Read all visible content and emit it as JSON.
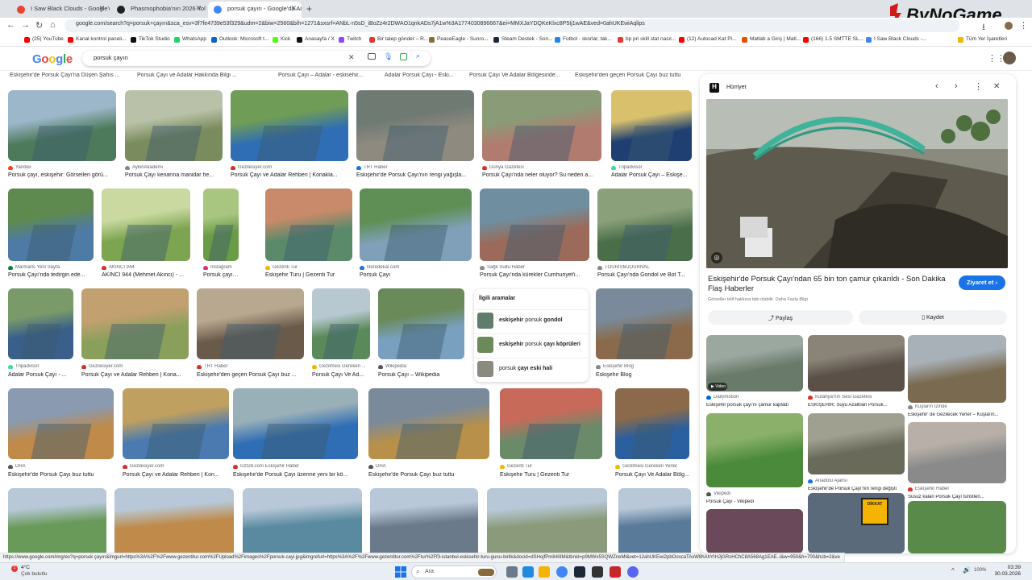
{
  "browser": {
    "tabs": [
      {
        "label": "I Saw Black Clouds - Google'da",
        "color": "#ea4335"
      },
      {
        "label": "Phasmophobia'nın 2026 Yol Ha...",
        "color": "#222222"
      },
      {
        "label": "porsuk çayırı - Google'da Ara",
        "color": "#4285f4"
      }
    ],
    "new_tab": "+",
    "url": "google.com/search?q=porsuk+çayırı&sca_esv=3f7fe4739e53f329&udm=2&biw=2560&bih=1271&sxsrf=ANbL-n5sD_iBoZz4r2DWAO1qnkADs7jA1w%3A1774030896667&ei=MMXJaYDQKeKlxc8P5Ij1wAE&ved=0ahUKEwiAqlips",
    "bookmarks": [
      {
        "label": "(25) YouTube",
        "color": "#ff0000"
      },
      {
        "label": "Kanal kontrol paneli...",
        "color": "#ff0000"
      },
      {
        "label": "TikTok Studio",
        "color": "#111111"
      },
      {
        "label": "WhatsApp",
        "color": "#25d366"
      },
      {
        "label": "Outlook: Microsoft t...",
        "color": "#0a64c8"
      },
      {
        "label": "Kick",
        "color": "#53fc18"
      },
      {
        "label": "Anasayfa / X",
        "color": "#111111"
      },
      {
        "label": "Twitch",
        "color": "#9146ff"
      },
      {
        "label": "Bir talep gönder – R...",
        "color": "#e53935"
      },
      {
        "label": "PeaceEagle - Sunro...",
        "color": "#8a6d3b"
      },
      {
        "label": "Steam Destek - Son...",
        "color": "#1b2838"
      },
      {
        "label": "Futbol - skorlar, tak...",
        "color": "#1e88e5"
      },
      {
        "label": "bp pri skill stat nasıl...",
        "color": "#e53935"
      },
      {
        "label": "(12) Autocad Kat Pl...",
        "color": "#ff0000"
      },
      {
        "label": "Matlab a Giriş | Matl...",
        "color": "#e65100"
      },
      {
        "label": "(166) 1.5 SMTTE SL...",
        "color": "#ff0000"
      },
      {
        "label": "I Saw Black Clouds -...",
        "color": "#4285f4"
      }
    ],
    "all_bookmarks": "Tüm Yer İşaretleri"
  },
  "google": {
    "logo": "Google",
    "query": "porsuk çayırı"
  },
  "top_strip": [
    "Eskişehir'de Porsuk Çayı'na Düşen Şahıs ...",
    "Porsuk Çayı ve Adalar Hakkında Bilgi ...",
    "Porsuk Çayı – Adalar - eskisehir...",
    "Adalar Porsuk Çayı - Eski...",
    "Porsuk Çayı Ve Adalar Bölgesinde...",
    "Eskişehir'den geçen Porsuk Çayı buz tuttu"
  ],
  "rows": [
    [
      {
        "src": "Yandex",
        "cap": "Porsuk çayı, eskişehir: Görselleri görü...",
        "c1": "#4d7a5a",
        "c2": "#9bb7c9",
        "sc": "#fc3f1d"
      },
      {
        "src": "AykiriAkademi",
        "cap": "Porsuk Çayı kenarına manidar he...",
        "c1": "#7a8b5e",
        "c2": "#b9c2a8",
        "sc": "#888888"
      },
      {
        "src": "Gezilesiyer.com",
        "cap": "Porsuk Çayı ve Adalar Rehberi | Konakla...",
        "c1": "#2f6db5",
        "c2": "#6f9c57",
        "sc": "#d93025"
      },
      {
        "src": "TRT Haber",
        "cap": "Eskişehir'de Porsuk Çayı'nın rengi yağışla...",
        "c1": "#8f8a80",
        "c2": "#6f7a73",
        "sc": "#1a73e8"
      },
      {
        "src": "Dünya Gazetesi",
        "cap": "Porsuk Çayı'nda neler oluyor? Su neden a...",
        "c1": "#b27b6f",
        "c2": "#8a9b78",
        "sc": "#d93025"
      },
      {
        "src": "Tripadvisor",
        "cap": "Adalar Porsuk Çayı – Eskişe...",
        "c1": "#1f3f73",
        "c2": "#d8c06d",
        "sc": "#34e0a1"
      }
    ],
    [
      {
        "src": "Marmaris Yeni Sayfa",
        "cap": "Porsuk Çayı'nda tedirgin ede...",
        "c1": "#4e7aa6",
        "c2": "#5f8a4f",
        "sc": "#0b8043"
      },
      {
        "src": "AKINCI 944",
        "cap": "AKINCI 944 (Mehmet Akıncı) - ...",
        "c1": "#7da450",
        "c2": "#c9d9a0",
        "sc": "#d93025"
      },
      {
        "src": "Instagram",
        "cap": "Porsuk çayı/Ad...",
        "c1": "#6a9b45",
        "c2": "#a8c680",
        "sc": "#e1306c"
      },
      {
        "src": "Gezenti Tur",
        "cap": "Eskişehir Turu | Gezenti Tur",
        "c1": "#5a8a6a",
        "c2": "#c88a6a",
        "sc": "#f4b400"
      },
      {
        "src": "Neredekal.com",
        "cap": "Porsuk Çayı",
        "c1": "#7fa0b8",
        "c2": "#5f8f55",
        "sc": "#1a73e8"
      },
      {
        "src": "Sağlı Sultu Haber",
        "cap": "Porsuk Çayı'nda kürekler Cumhuriyet'i...",
        "c1": "#9b6a5a",
        "c2": "#6f8fa0",
        "sc": "#888888"
      },
      {
        "src": "TOURISMJOURNAL",
        "cap": "Porsuk Çayı'nda Gondol ve Bot T...",
        "c1": "#4a6e4a",
        "c2": "#8aa07a",
        "sc": "#888888"
      }
    ],
    [
      {
        "src": "Tripadvisor",
        "cap": "Adalar Porsuk Çayı - ...",
        "c1": "#3a5f8a",
        "c2": "#7a9a6a",
        "sc": "#34e0a1"
      },
      {
        "src": "Gezilesiyer.com",
        "cap": "Porsuk Çayı ve Adalar Rehberi | Kona...",
        "c1": "#8aa05a",
        "c2": "#c2a070",
        "sc": "#d93025"
      },
      {
        "src": "TRT Haber",
        "cap": "Eskişehir'den geçen Porsuk Çayı buz ...",
        "c1": "#6a5a4a",
        "c2": "#b8a890",
        "sc": "#d93025"
      },
      {
        "src": "Gezilmesi Gereken ...",
        "cap": "Porsuk Çayı Ve Ad...",
        "c1": "#5a8a5a",
        "c2": "#b8c8d0",
        "sc": "#f4b400"
      },
      {
        "src": "Wikipedia",
        "cap": "Porsuk Çayı – Wikipedia",
        "c1": "#7aa0c0",
        "c2": "#6a8a5a",
        "sc": "#555555"
      },
      {
        "src": "Eskişehir Blog",
        "cap": "Eskişehir Blog",
        "c1": "#8a6a4a",
        "c2": "#7a8a9a",
        "sc": "#888888"
      }
    ],
    [
      {
        "src": "DHA",
        "cap": "Eskişehir'de Porsuk Çayı buz tuttu",
        "c1": "#c08a4a",
        "c2": "#8a9ab0",
        "sc": "#555555"
      },
      {
        "src": "Gezilesiyer.com",
        "cap": "Porsuk Çayı ve Adalar Rehberi | Kon...",
        "c1": "#4a7ab0",
        "c2": "#c0a060",
        "sc": "#d93025"
      },
      {
        "src": "Gzt28.com Eskişehir Haber",
        "cap": "Eskişehir'de Porsuk Çayı üzerine yeni bir kö...",
        "c1": "#2f6db5",
        "c2": "#9ab0b8",
        "sc": "#d93025"
      },
      {
        "src": "DHA",
        "cap": "Eskişehir'de Porsuk Çayı buz tuttu",
        "c1": "#b8904a",
        "c2": "#7a8a9a",
        "sc": "#555555"
      },
      {
        "src": "Gezenti Tur",
        "cap": "Eskişehir Turu | Gezenti Tur",
        "c1": "#6a8a6a",
        "c2": "#c86a5a",
        "sc": "#f4b400"
      },
      {
        "src": "Gezilmesi Gereken Yerler",
        "cap": "Porsuk Çayı Ve Adalar Bölg...",
        "c1": "#2a5fa0",
        "c2": "#8a6a4a",
        "sc": "#f4b400"
      }
    ]
  ],
  "related": {
    "title": "İlgili aramalar",
    "items": [
      {
        "bold": "eskişehir",
        "rest": " porsuk ",
        "bold2": "gondol"
      },
      {
        "bold": "eskişehir",
        "rest": " porsuk ",
        "bold2": "çayı köprüleri"
      },
      {
        "bold": "",
        "rest": "porsuk ",
        "bold2": "çayı eski hali"
      }
    ]
  },
  "panel": {
    "site": "Hürriyet",
    "title": "Eskişehir'de Porsuk Çayı'ndan 65 bin ton çamur çıkarıldı - Son Dakika Flaş Haberler",
    "visit": "Ziyaret et",
    "copyright": "Görseller telif hakkına tabi olabilir. Daha Fazla Bilgi",
    "share": "Paylaş",
    "save": "Kaydet",
    "video_badge": "Video",
    "grid": [
      {
        "src": "Dailymotion",
        "cap": "Eskişehir porsuk çayı'nı çamur kapladı",
        "c1": "#6a7a6a",
        "c2": "#9aa8a0",
        "sc": "#0066dc"
      },
      {
        "src": "Kütahya'nın Sesi Gazetesi",
        "cap": "ESKİŞEHİR; Suyu Azaltılan Porsuk...",
        "c1": "#5a5048",
        "c2": "#8a8478",
        "sc": "#d93025"
      },
      {
        "src": "Kuşların İzinde",
        "cap": "Eskişehir' de Gezilecek Yerler – Kuşların...",
        "c1": "#7a6a50",
        "c2": "#a8b0b8",
        "sc": "#888888"
      },
      {
        "src": "Vikipedi",
        "cap": "Porsuk Çayı - Vikipedi",
        "c1": "#4a8a3a",
        "c2": "#8ab06a",
        "sc": "#555555"
      },
      {
        "src": "Anadolu Ajansı",
        "cap": "Eskişehir'de Porsuk Çayı'nın rengi değişti",
        "c1": "#6a6a5a",
        "c2": "#a0a090",
        "sc": "#1a73e8"
      },
      {
        "src": "Eskişehir Haber",
        "cap": "Susuz kalan Porsuk Çayı turistleri...",
        "c1": "#8a8a8a",
        "c2": "#b8b0a8",
        "sc": "#d93025"
      }
    ],
    "sign_text": "DİKKAT"
  },
  "status_url": "https://www.google.com/imgres?q=porsuk çayırı&imgurl=https%3A%2F%2Fwww.gezentitur.com%2FUpload%2Fimages%2Fporsuk-cayi.jpg&imgrefurl=https%3A%2F%2Fwww.gezentitur.com%2Ftur%2Ff3-istanbul-eskisehir-turu-gunu-birlik&docid=dSHojfPm84IlIM&tbnid=p9MWx5SQWZneMl&vet=12ahUKEwi2pbOoscaTAxW8hAhYIHJjGRsHChC8A568Ag1EAE..i&w=950&h=700&hcb=2&ve",
  "taskbar": {
    "weather_temp": "4°C",
    "weather_desc": "Çok bulutlu",
    "search": "Ara",
    "time": "03:39",
    "date": "30.03.2026",
    "volume_pct": "100%"
  },
  "watermark": "ByNoGame"
}
